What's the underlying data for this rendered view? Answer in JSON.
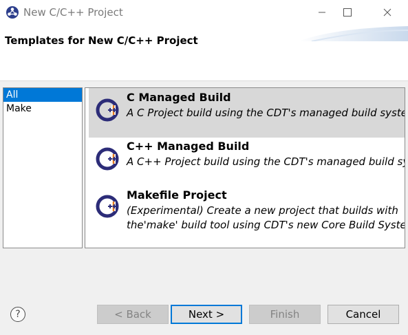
{
  "window": {
    "title": "New C/C++ Project",
    "controls": [
      "minimize-icon",
      "maximize-icon",
      "close-icon"
    ]
  },
  "header": {
    "title": "Templates for New C/C++ Project"
  },
  "categories": [
    {
      "label": "All",
      "selected": true
    },
    {
      "label": "Make",
      "selected": false
    }
  ],
  "templates": [
    {
      "name": "C Managed Build",
      "description": [
        "A C Project build using the CDT's managed build system"
      ],
      "selected": true,
      "icon": "cdt-icon"
    },
    {
      "name": "C++ Managed Build",
      "description": [
        "A C++ Project build using the CDT's managed build system"
      ],
      "selected": false,
      "icon": "cdt-icon"
    },
    {
      "name": "Makefile Project",
      "description": [
        "(Experimental) Create a new project that builds with",
        "the'make' build tool using CDT's new Core Build System"
      ],
      "selected": false,
      "icon": "cdt-icon"
    }
  ],
  "buttons": {
    "help": "?",
    "back": "< Back",
    "next": "Next >",
    "finish": "Finish",
    "cancel": "Cancel"
  },
  "colors": {
    "selection": "#0078d7",
    "selected_row": "#d8d8d8",
    "icon_ring": "#2c2c78",
    "icon_accent": "#e87a1d"
  }
}
